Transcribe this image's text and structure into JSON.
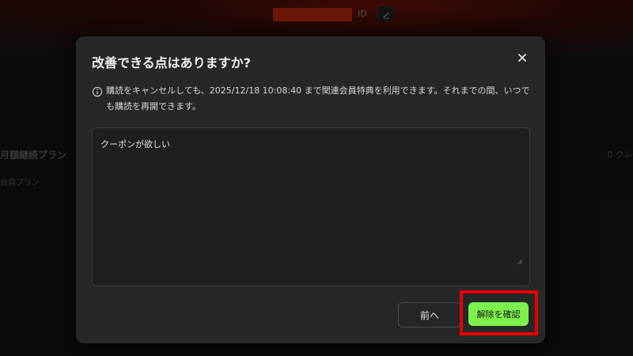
{
  "background": {
    "user_id_label": "ID",
    "plan_title": "月額継続プラン",
    "plan_sub": "会員プラン",
    "credit_text": "0 クレ"
  },
  "modal": {
    "title": "改善できる点はありますか?",
    "notice": "購読をキャンセルしても、2025/12/18 10:08:40 まで関連会員特典を利用できます。それまでの間、いつでも購読を再開できます。",
    "reason_value": "クーポンが欲しい",
    "back_label": "前へ",
    "confirm_label": "解除を確認"
  },
  "colors": {
    "confirm_bg": "#7cf04c",
    "highlight": "#e50000",
    "modal_bg": "#272727"
  },
  "icons": [
    "edit-icon",
    "close-icon",
    "info-icon",
    "resize-handle-icon"
  ]
}
